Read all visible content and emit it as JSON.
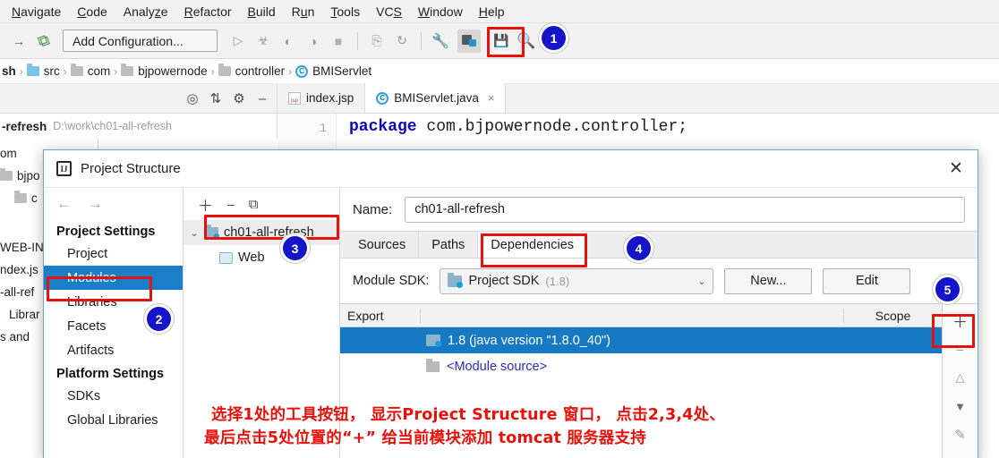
{
  "menubar": {
    "items": [
      {
        "label": "Navigate",
        "mnemonic": "N"
      },
      {
        "label": "Code",
        "mnemonic": "C"
      },
      {
        "label": "Analyze",
        "mnemonic": "z"
      },
      {
        "label": "Refactor",
        "mnemonic": "R"
      },
      {
        "label": "Build",
        "mnemonic": "B"
      },
      {
        "label": "Run",
        "mnemonic": "u"
      },
      {
        "label": "Tools",
        "mnemonic": "T"
      },
      {
        "label": "VCS",
        "mnemonic": "S"
      },
      {
        "label": "Window",
        "mnemonic": "W"
      },
      {
        "label": "Help",
        "mnemonic": "H"
      }
    ]
  },
  "toolbar": {
    "forward_icon": "arrow-right-icon",
    "build_icon": "hammer-icon",
    "run_config_label": "Add Configuration...",
    "run_icon": "run-triangle-icon",
    "debug_icon": "debug-bug-icon",
    "coverage_icon": "run-coverage-icon",
    "profile_icon": "run-profiler-icon",
    "stop_icon": "stop-square-icon",
    "update_icon": "update-app-icon",
    "redeploy_icon": "redeploy-icon",
    "settings_icon": "wrench-icon",
    "project_structure_icon": "project-structure-icon",
    "sync_icon": "sync-icon",
    "search_icon": "search-magnifier-icon",
    "layout_icon": "layout-icon"
  },
  "breadcrumb": {
    "items": [
      {
        "label": "sh",
        "icon": "truncated-text"
      },
      {
        "label": "src",
        "icon": "folder-blue-icon"
      },
      {
        "label": "com",
        "icon": "folder-gray-icon"
      },
      {
        "label": "bjpowernode",
        "icon": "folder-gray-icon"
      },
      {
        "label": "controller",
        "icon": "folder-gray-icon"
      },
      {
        "label": "BMIServlet",
        "icon": "java-class-icon"
      }
    ],
    "separator": "›"
  },
  "project_panel": {
    "icons": [
      "locate-target-icon",
      "collapse-all-icon",
      "settings-gear-icon",
      "hide-minus-icon"
    ],
    "row_name": "-refresh",
    "row_path": "D:\\work\\ch01-all-refresh",
    "background_tree": [
      "om",
      "bjpo",
      "c",
      "WEB-IN",
      "ndex.js",
      "-all-ref",
      "Librar",
      "s and"
    ]
  },
  "editor": {
    "tabs": [
      {
        "label": "index.jsp",
        "icon": "jsp-file-icon",
        "active": false,
        "closable": false
      },
      {
        "label": "BMIServlet.java",
        "icon": "java-class-icon",
        "active": true,
        "closable": true
      }
    ],
    "close_glyph": "×",
    "line_number": "1",
    "code_keyword": "package",
    "code_rest": " com.bjpowernode.controller;"
  },
  "dialog": {
    "title": "Project Structure",
    "logo_icon": "intellij-idea-logo-icon",
    "close_glyph": "✕",
    "nav": {
      "back_icon": "arrow-left-icon",
      "forward_icon": "arrow-right-icon"
    },
    "sidebar": {
      "groups": [
        {
          "title": "Project Settings",
          "items": [
            {
              "label": "Project",
              "selected": false
            },
            {
              "label": "Modules",
              "selected": true
            },
            {
              "label": "Libraries",
              "selected": false
            },
            {
              "label": "Facets",
              "selected": false
            },
            {
              "label": "Artifacts",
              "selected": false
            }
          ]
        },
        {
          "title": "Platform Settings",
          "items": [
            {
              "label": "SDKs",
              "selected": false
            },
            {
              "label": "Global Libraries",
              "selected": false
            }
          ]
        }
      ]
    },
    "modules": {
      "tools": [
        "add-plus-icon",
        "remove-minus-icon",
        "copy-icon"
      ],
      "tree": [
        {
          "label": "ch01-all-refresh",
          "icon": "module-icon",
          "level": 0,
          "expanded": true
        },
        {
          "label": "Web",
          "icon": "web-facet-icon",
          "level": 1
        }
      ],
      "chevron": "⌄"
    },
    "name_label": "Name:",
    "name_value": "ch01-all-refresh",
    "tabs": [
      {
        "label": "Sources",
        "active": false
      },
      {
        "label": "Paths",
        "active": false
      },
      {
        "label": "Dependencies",
        "active": true
      }
    ],
    "sdk_label": "Module SDK:",
    "sdk_value": "Project SDK",
    "sdk_version": "(1.8)",
    "sdk_icon": "jdk-icon",
    "sdk_chevron": "⌄",
    "sdk_new_button": "New...",
    "sdk_edit_button": "Edit",
    "dep_columns": {
      "export": "Export",
      "scope": "Scope"
    },
    "dep_rows": [
      {
        "label": "1.8 (java version \"1.8.0_40\")",
        "icon": "jdk-icon",
        "selected": true
      },
      {
        "label": "<Module source>",
        "icon": "module-source-icon",
        "selected": false
      }
    ],
    "side_buttons": [
      {
        "icon": "add-plus-icon",
        "glyph": "＋"
      },
      {
        "icon": "remove-minus-icon",
        "glyph": "–"
      },
      {
        "icon": "move-up-icon",
        "glyph": "△"
      },
      {
        "icon": "move-down-icon",
        "glyph": "▼"
      },
      {
        "icon": "edit-pencil-icon",
        "glyph": "✎"
      }
    ]
  },
  "annotations": {
    "badges": [
      {
        "number": "1",
        "target": "project-structure-toolbar-button"
      },
      {
        "number": "2",
        "target": "sidebar-item-modules"
      },
      {
        "number": "3",
        "target": "module-tree-ch01-all-refresh"
      },
      {
        "number": "4",
        "target": "tab-dependencies"
      },
      {
        "number": "5",
        "target": "dependency-add-button"
      }
    ],
    "note_line1": "选择1处的工具按钮， 显示Project Structure 窗口， 点击2,3,4处、",
    "note_line2": "最后点击5处位置的“+” 给当前模块添加 tomcat 服务器支持"
  },
  "colors": {
    "selection_blue": "#1a7ec8",
    "row_selection_blue": "#1679c4",
    "annotation_red": "#e8120c",
    "badge_blue": "#1414c8",
    "keyword_blue": "#0b06b8",
    "link_blue": "#2b2bc0"
  }
}
